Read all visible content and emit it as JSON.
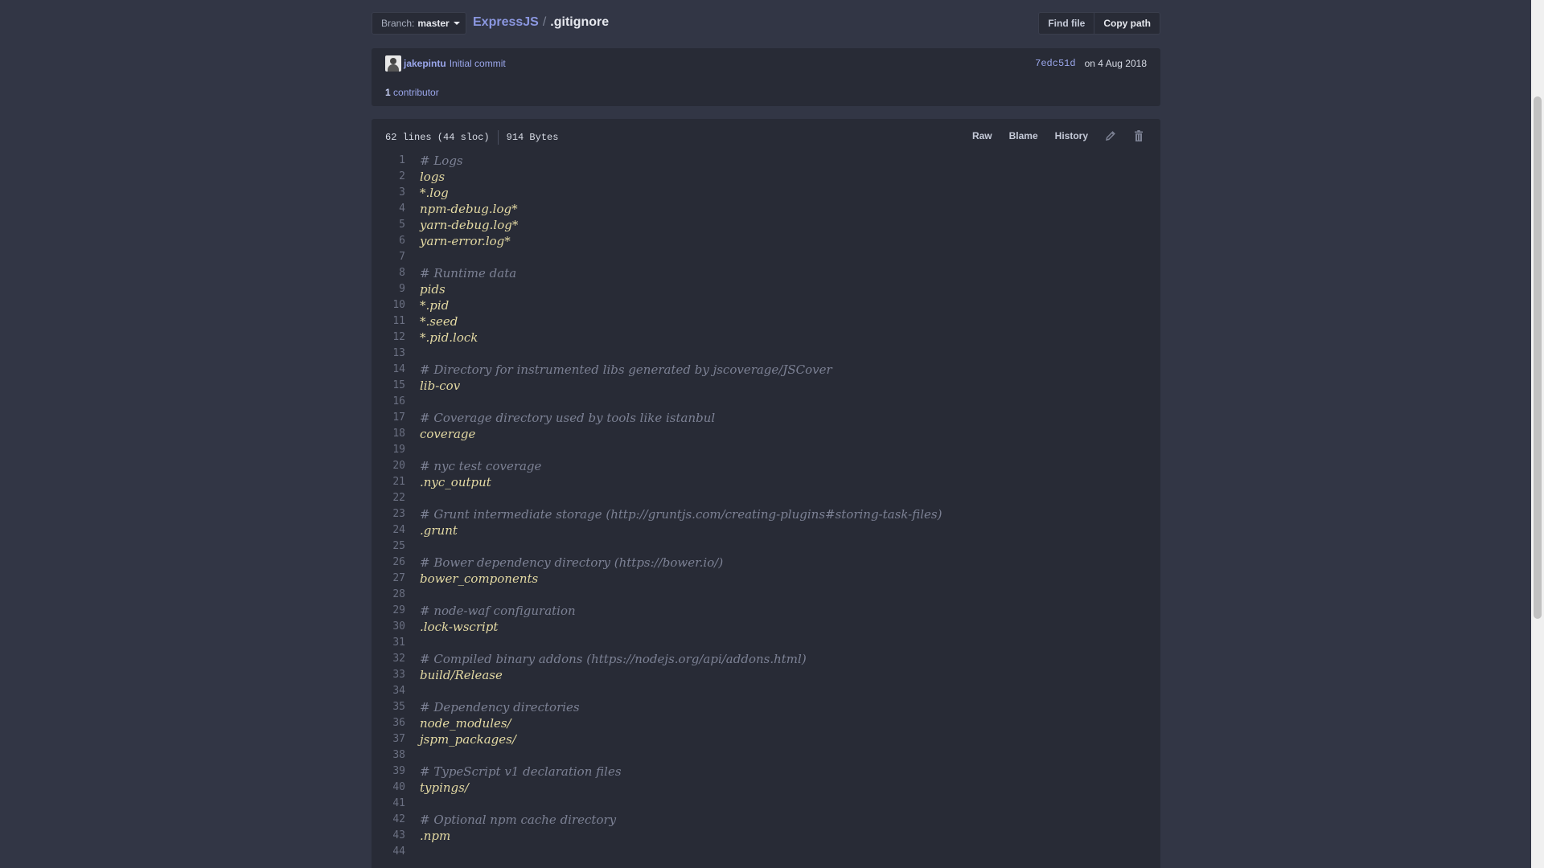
{
  "branch": {
    "label": "Branch:",
    "name": "master"
  },
  "breadcrumb": {
    "repo": "ExpressJS",
    "separator": "/",
    "file": ".gitignore"
  },
  "toolbar": {
    "find_file": "Find file",
    "copy_path": "Copy path"
  },
  "commit": {
    "author": "jakepintu",
    "message": "Initial commit",
    "sha": "7edc51d",
    "date": "on 4 Aug 2018"
  },
  "contributors": {
    "count": "1",
    "label": "contributor"
  },
  "file": {
    "lines_info": "62 lines (44 sloc)",
    "size": "914 Bytes",
    "actions": {
      "raw": "Raw",
      "blame": "Blame",
      "history": "History"
    },
    "icons": {
      "edit": "pencil-icon",
      "delete": "trash-icon"
    }
  },
  "code_lines": [
    {
      "n": "1",
      "text": "# Logs",
      "type": "comment"
    },
    {
      "n": "2",
      "text": "logs",
      "type": "code"
    },
    {
      "n": "3",
      "text": "*.log",
      "type": "code"
    },
    {
      "n": "4",
      "text": "npm-debug.log*",
      "type": "code"
    },
    {
      "n": "5",
      "text": "yarn-debug.log*",
      "type": "code"
    },
    {
      "n": "6",
      "text": "yarn-error.log*",
      "type": "code"
    },
    {
      "n": "7",
      "text": "",
      "type": "code"
    },
    {
      "n": "8",
      "text": "# Runtime data",
      "type": "comment"
    },
    {
      "n": "9",
      "text": "pids",
      "type": "code"
    },
    {
      "n": "10",
      "text": "*.pid",
      "type": "code"
    },
    {
      "n": "11",
      "text": "*.seed",
      "type": "code"
    },
    {
      "n": "12",
      "text": "*.pid.lock",
      "type": "code"
    },
    {
      "n": "13",
      "text": "",
      "type": "code"
    },
    {
      "n": "14",
      "text": "# Directory for instrumented libs generated by jscoverage/JSCover",
      "type": "comment"
    },
    {
      "n": "15",
      "text": "lib-cov",
      "type": "code"
    },
    {
      "n": "16",
      "text": "",
      "type": "code"
    },
    {
      "n": "17",
      "text": "# Coverage directory used by tools like istanbul",
      "type": "comment"
    },
    {
      "n": "18",
      "text": "coverage",
      "type": "code"
    },
    {
      "n": "19",
      "text": "",
      "type": "code"
    },
    {
      "n": "20",
      "text": "# nyc test coverage",
      "type": "comment"
    },
    {
      "n": "21",
      "text": ".nyc_output",
      "type": "code"
    },
    {
      "n": "22",
      "text": "",
      "type": "code"
    },
    {
      "n": "23",
      "text": "# Grunt intermediate storage (http://gruntjs.com/creating-plugins#storing-task-files)",
      "type": "comment"
    },
    {
      "n": "24",
      "text": ".grunt",
      "type": "code"
    },
    {
      "n": "25",
      "text": "",
      "type": "code"
    },
    {
      "n": "26",
      "text": "# Bower dependency directory (https://bower.io/)",
      "type": "comment"
    },
    {
      "n": "27",
      "text": "bower_components",
      "type": "code"
    },
    {
      "n": "28",
      "text": "",
      "type": "code"
    },
    {
      "n": "29",
      "text": "# node-waf configuration",
      "type": "comment"
    },
    {
      "n": "30",
      "text": ".lock-wscript",
      "type": "code"
    },
    {
      "n": "31",
      "text": "",
      "type": "code"
    },
    {
      "n": "32",
      "text": "# Compiled binary addons (https://nodejs.org/api/addons.html)",
      "type": "comment"
    },
    {
      "n": "33",
      "text": "build/Release",
      "type": "code"
    },
    {
      "n": "34",
      "text": "",
      "type": "code"
    },
    {
      "n": "35",
      "text": "# Dependency directories",
      "type": "comment"
    },
    {
      "n": "36",
      "text": "node_modules/",
      "type": "code"
    },
    {
      "n": "37",
      "text": "jspm_packages/",
      "type": "code"
    },
    {
      "n": "38",
      "text": "",
      "type": "code"
    },
    {
      "n": "39",
      "text": "# TypeScript v1 declaration files",
      "type": "comment"
    },
    {
      "n": "40",
      "text": "typings/",
      "type": "code"
    },
    {
      "n": "41",
      "text": "",
      "type": "code"
    },
    {
      "n": "42",
      "text": "# Optional npm cache directory",
      "type": "comment"
    },
    {
      "n": "43",
      "text": ".npm",
      "type": "code"
    },
    {
      "n": "44",
      "text": "",
      "type": "code"
    }
  ]
}
